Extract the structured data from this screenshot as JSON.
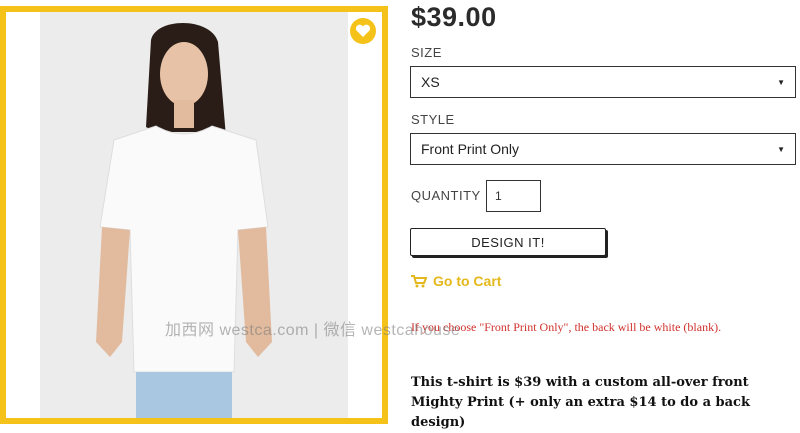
{
  "product": {
    "price": "$39.00",
    "image_alt": "white t-shirt on model",
    "wishlist_icon": "heart-icon"
  },
  "options": {
    "size_label": "SIZE",
    "size_value": "XS",
    "style_label": "STYLE",
    "style_value": "Front Print Only",
    "quantity_label": "QUANTITY",
    "quantity_value": "1"
  },
  "actions": {
    "design_label": "DESIGN IT!",
    "cart_label": "Go to Cart",
    "cart_icon": "cart-icon"
  },
  "notes": {
    "red_note": "If you choose \"Front Print Only\", the back will be white (blank).",
    "bold_note": "This t-shirt is $39 with a custom all-over front Mighty Print (+ only an extra $14 to do a back design)"
  },
  "watermark": "加西网 westca.com | 微信 westcahouse",
  "colors": {
    "accent": "#f5c21a",
    "note_red": "#d0312d",
    "cart_gold": "#e4b81a"
  }
}
